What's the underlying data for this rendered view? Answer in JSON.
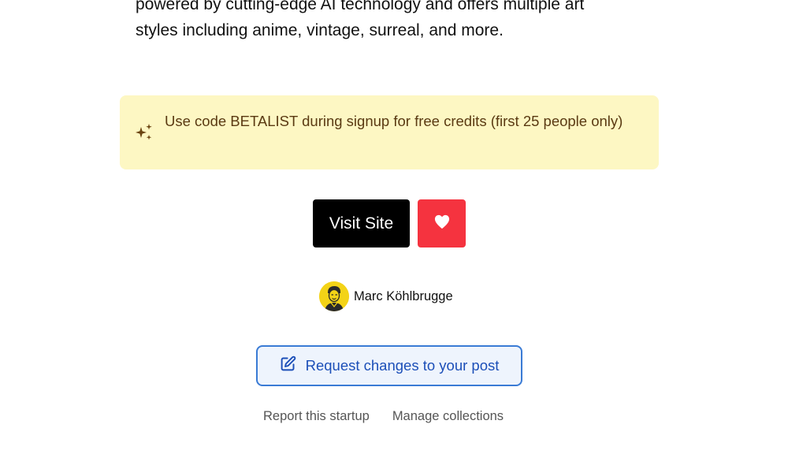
{
  "description": {
    "line1": "powered by cutting-edge AI technology and offers multiple art",
    "line2": "styles including anime, vintage, surreal, and more."
  },
  "promo": {
    "icon": "sparkles-icon",
    "text": "Use code BETALIST during signup for free credits (first 25 people only)",
    "background": "#fdf7c3",
    "text_color": "#5a3a12"
  },
  "actions": {
    "visit_label": "Visit Site",
    "heart_icon": "heart-icon",
    "heart_color": "#f5333f"
  },
  "maker": {
    "name": "Marc Köhlbrugge",
    "avatar_color": "#f3d317"
  },
  "request": {
    "icon": "edit-icon",
    "label": "Request changes to your post",
    "accent": "#1c4fb8"
  },
  "footer": {
    "report_label": "Report this startup",
    "collections_label": "Manage collections"
  }
}
